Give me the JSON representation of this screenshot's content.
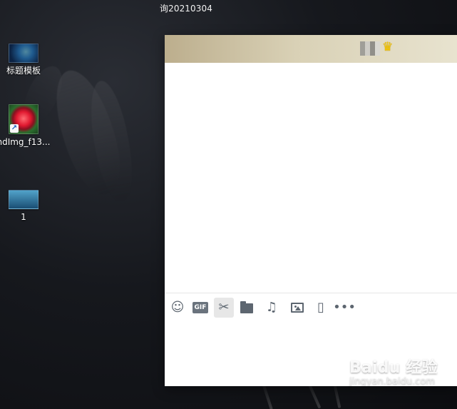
{
  "top_caption": "询20210304",
  "desktop": {
    "icons": [
      {
        "label": "标题模板",
        "icon": "title-template-thumbnail-icon"
      },
      {
        "label": "ndImg_f13...",
        "icon": "rose-image-shortcut-icon",
        "shortcut_glyph": "↗"
      },
      {
        "label": "1",
        "icon": "blue-file-thumbnail-icon"
      }
    ]
  },
  "chat_window": {
    "header": {
      "contact_name_redacted": true,
      "vip_icon": "crown-icon",
      "vip_glyph": "♛"
    },
    "toolbar": {
      "emoji_glyph": "☺",
      "gif_label": "GIF",
      "cut_glyph": "✂",
      "folder_icon": "folder-icon",
      "music_glyph": "♫",
      "image_icon": "image-icon",
      "vibrate_glyph": "▯",
      "more_label": "•••"
    }
  },
  "watermark": {
    "brand": "Baidu 经验",
    "site": "jingyan.baidu.com"
  },
  "colors": {
    "desktop_background": "#16181d",
    "header_gradient_start": "#bcae8d",
    "header_gradient_end": "#e8e3cf",
    "toolbar_icon": "#5d6670",
    "active_tool_background": "#e7e7e7"
  }
}
